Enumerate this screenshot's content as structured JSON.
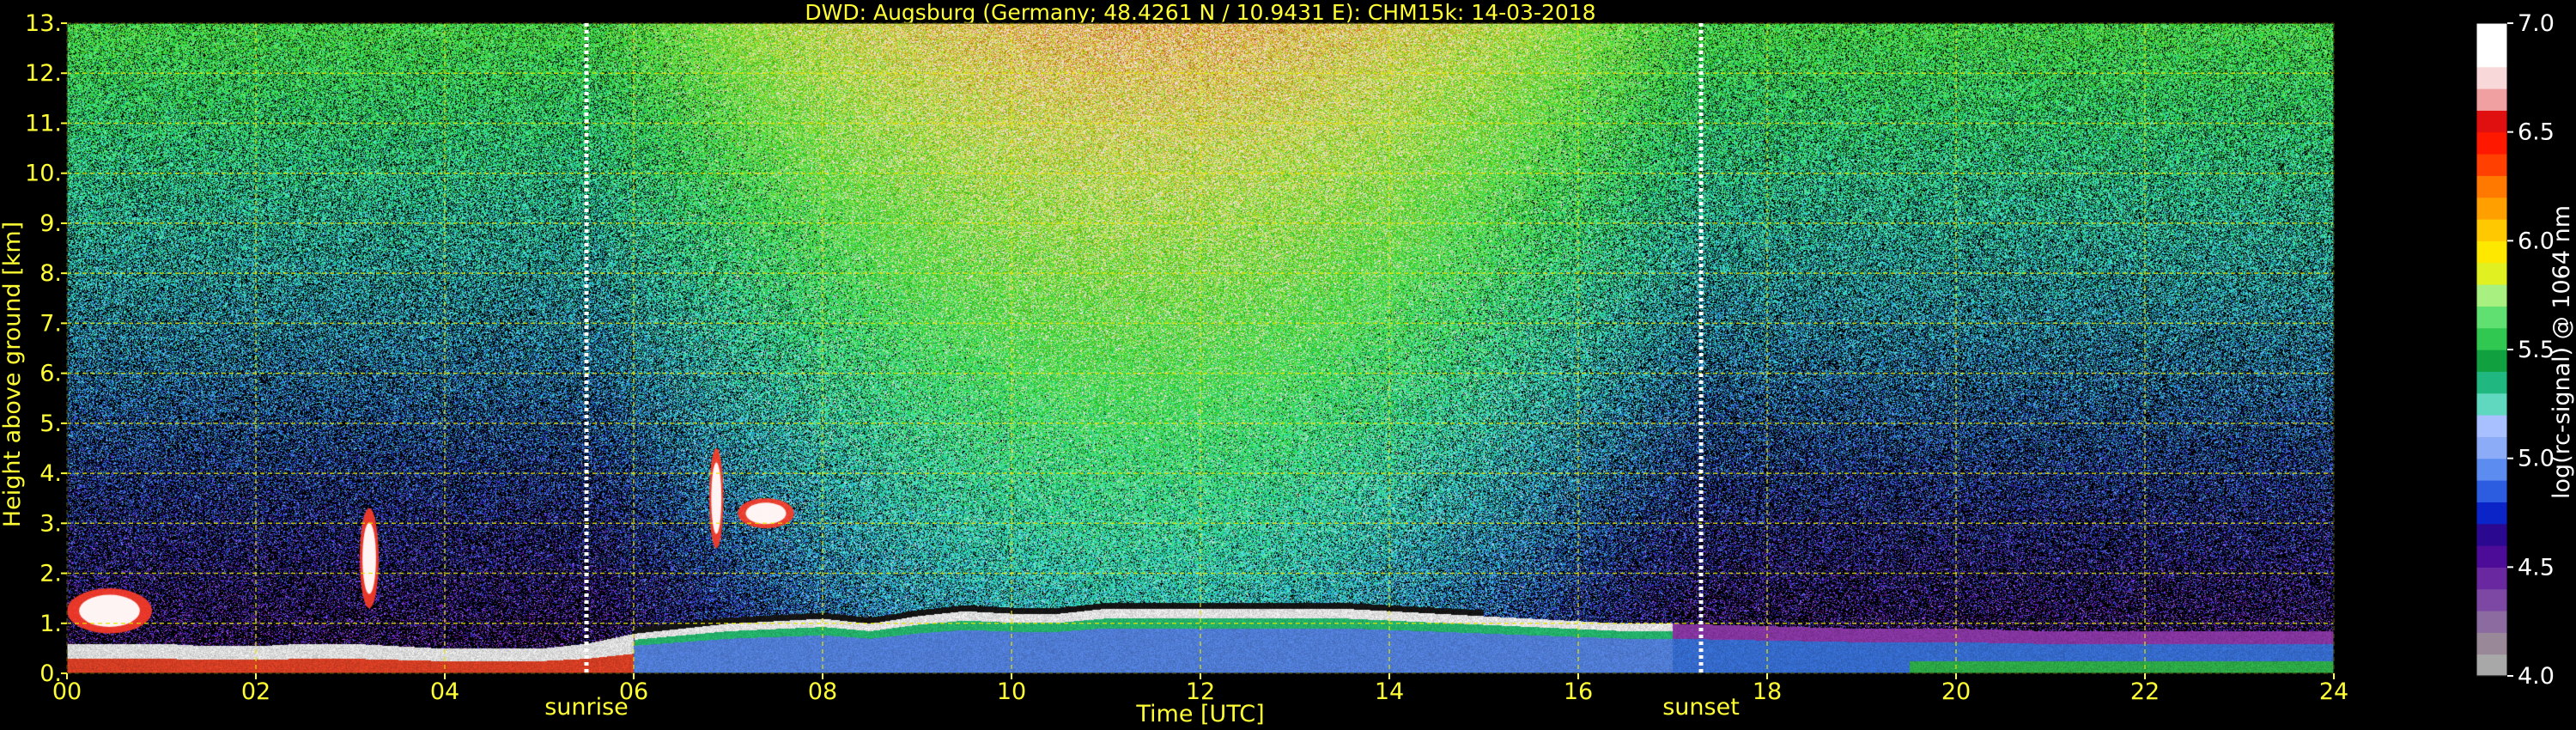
{
  "chart_data": {
    "type": "heatmap",
    "title": "DWD: Augsburg (Germany; 48.4261 N / 10.9431 E):    CHM15k: 14-03-2018",
    "xlabel": "Time [UTC]",
    "ylabel": "Height above ground [km]",
    "xlim": [
      0,
      24
    ],
    "ylim": [
      0,
      13
    ],
    "x_ticks": [
      "00",
      "02",
      "04",
      "06",
      "08",
      "10",
      "12",
      "14",
      "16",
      "18",
      "20",
      "22",
      "24"
    ],
    "y_ticks": [
      "0.",
      "1.",
      "2.",
      "3.",
      "4.",
      "5.",
      "6.",
      "7.",
      "8.",
      "9.",
      "10.",
      "11.",
      "12.",
      "13."
    ],
    "grid": true,
    "annotations": [
      {
        "label": "sunrise",
        "time_utc": 5.5
      },
      {
        "label": "sunset",
        "time_utc": 17.3
      }
    ],
    "colorbar": {
      "label": "log(rc-signal) @ 1064 nm",
      "range": [
        4.0,
        7.0
      ],
      "ticks": [
        "4.0",
        "4.5",
        "5.0",
        "5.5",
        "6.0",
        "6.5",
        "7.0"
      ],
      "colors": [
        "#a8a8a8",
        "#988898",
        "#8c6ca0",
        "#7c48a4",
        "#6a28a0",
        "#4c0c98",
        "#2a0890",
        "#0a24c8",
        "#2c5ce0",
        "#5c8cf0",
        "#8cacf8",
        "#a8c0ff",
        "#60d8c0",
        "#20b880",
        "#10a040",
        "#30c850",
        "#60e070",
        "#a8f080",
        "#e0f020",
        "#ffe800",
        "#ffc800",
        "#ffa000",
        "#ff7800",
        "#ff4000",
        "#ff1800",
        "#e01010",
        "#f0a0a0",
        "#f8d8d8",
        "#ffffff",
        "#ffffff"
      ]
    },
    "boundary_layer_km": [
      [
        0,
        0.6
      ],
      [
        0.5,
        0.6
      ],
      [
        1,
        0.6
      ],
      [
        1.5,
        0.55
      ],
      [
        2,
        0.55
      ],
      [
        2.5,
        0.6
      ],
      [
        3,
        0.6
      ],
      [
        3.5,
        0.55
      ],
      [
        4,
        0.5
      ],
      [
        4.5,
        0.5
      ],
      [
        5,
        0.5
      ],
      [
        5.5,
        0.6
      ],
      [
        6,
        0.8
      ],
      [
        6.5,
        0.9
      ],
      [
        7,
        1.0
      ],
      [
        7.5,
        1.05
      ],
      [
        8,
        1.1
      ],
      [
        8.5,
        1.0
      ],
      [
        9,
        1.15
      ],
      [
        9.5,
        1.25
      ],
      [
        10,
        1.2
      ],
      [
        10.5,
        1.2
      ],
      [
        11,
        1.3
      ],
      [
        11.5,
        1.3
      ],
      [
        12,
        1.3
      ],
      [
        12.5,
        1.3
      ],
      [
        13,
        1.3
      ],
      [
        13.5,
        1.3
      ],
      [
        14,
        1.25
      ],
      [
        14.5,
        1.2
      ],
      [
        15,
        1.15
      ],
      [
        15.5,
        1.1
      ],
      [
        16,
        1.05
      ],
      [
        16.5,
        1.0
      ],
      [
        17,
        1.0
      ],
      [
        18,
        0.95
      ],
      [
        19,
        0.9
      ],
      [
        20,
        0.9
      ],
      [
        21,
        0.85
      ],
      [
        22,
        0.85
      ],
      [
        23,
        0.85
      ],
      [
        24,
        0.85
      ]
    ],
    "cloud_features": [
      {
        "t0": 7.1,
        "t1": 7.7,
        "h0": 2.9,
        "h1": 3.5,
        "value": 7.0
      },
      {
        "t0": 0.0,
        "t1": 0.9,
        "h0": 0.8,
        "h1": 1.7,
        "value": 6.8
      },
      {
        "t0": 3.1,
        "t1": 3.3,
        "h0": 1.3,
        "h1": 3.3,
        "value": 6.2
      },
      {
        "t0": 6.8,
        "t1": 6.95,
        "h0": 2.5,
        "h1": 4.5,
        "value": 5.8
      }
    ]
  }
}
